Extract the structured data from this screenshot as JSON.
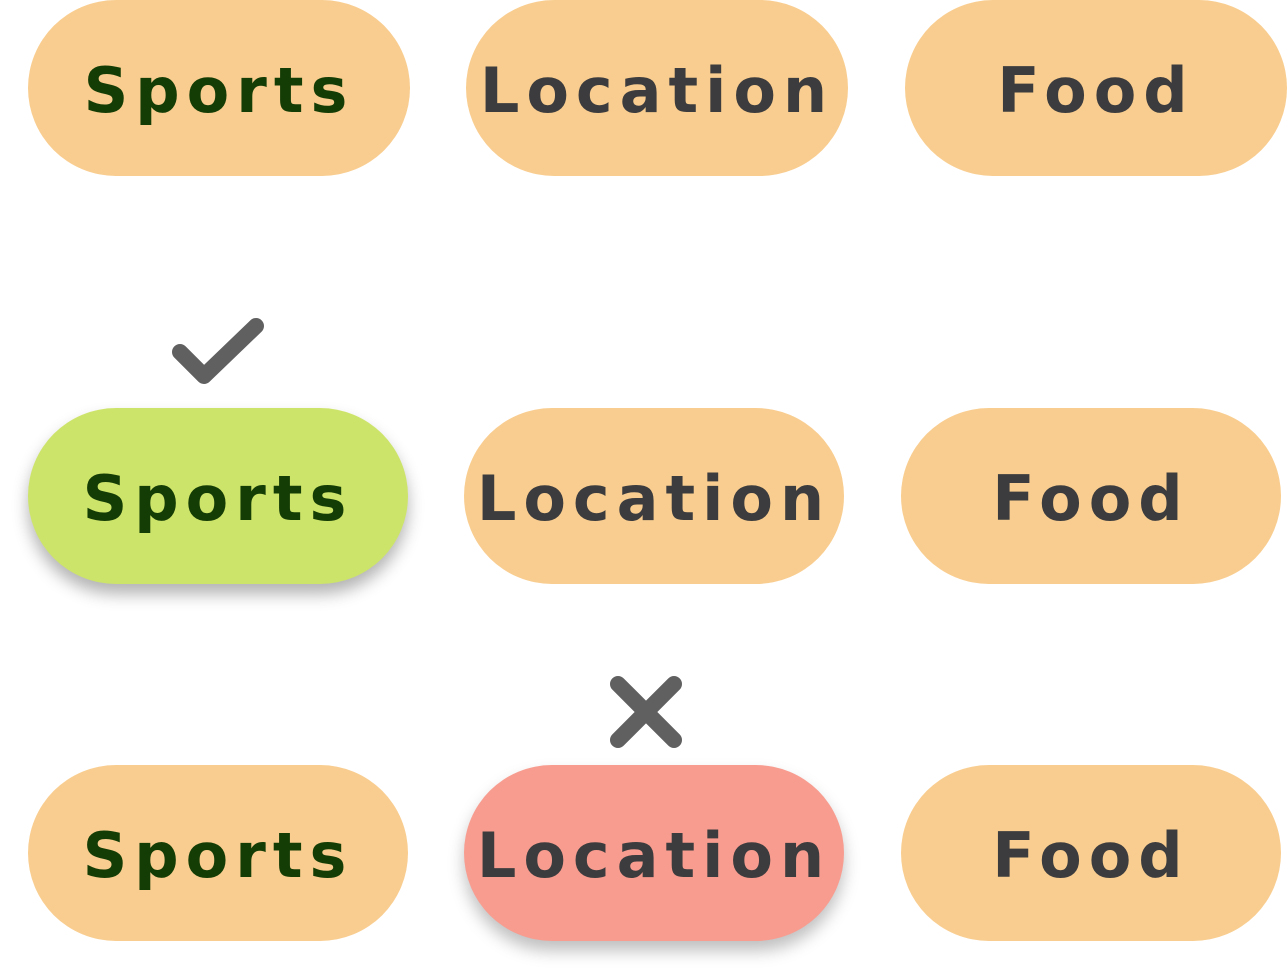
{
  "colors": {
    "chip_default": "#f9cd8f",
    "chip_correct": "#cde46a",
    "chip_wrong": "#f89c8f",
    "text_dark": "#3c3c3e",
    "text_green": "#143c05",
    "mark_gray": "#606060"
  },
  "rows": [
    {
      "state": "unselected",
      "chips": [
        {
          "label": "Sports"
        },
        {
          "label": "Location"
        },
        {
          "label": "Food"
        }
      ]
    },
    {
      "state": "correct-selected",
      "mark_icon": "checkmark-icon",
      "chips": [
        {
          "label": "Sports",
          "status": "correct"
        },
        {
          "label": "Location"
        },
        {
          "label": "Food"
        }
      ]
    },
    {
      "state": "wrong-selected",
      "mark_icon": "cross-icon",
      "chips": [
        {
          "label": "Sports"
        },
        {
          "label": "Location",
          "status": "wrong"
        },
        {
          "label": "Food"
        }
      ]
    }
  ]
}
